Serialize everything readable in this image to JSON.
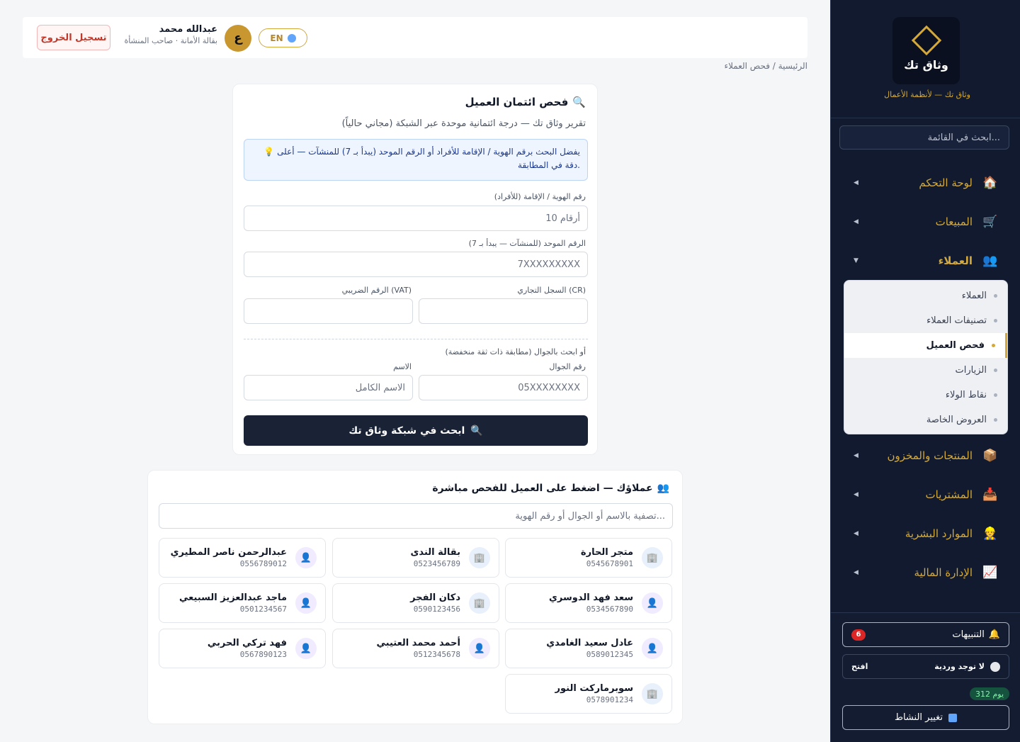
{
  "sidebar": {
    "logo_text": "وثاق تك",
    "tagline": "وثاق تك — لأنظمة الأعمال",
    "search_placeholder": "ابحث في القائمة...",
    "items": [
      {
        "label": "لوحة التحكم",
        "icon": "house-icon",
        "glyph": "🏠"
      },
      {
        "label": "المبيعات",
        "icon": "cart-icon",
        "glyph": "🛒"
      },
      {
        "label": "العملاء",
        "icon": "people-icon",
        "glyph": "👥"
      },
      {
        "label": "المنتجات والمخزون",
        "icon": "box-icon",
        "glyph": "📦"
      },
      {
        "label": "المشتريات",
        "icon": "inbox-icon",
        "glyph": "📥"
      },
      {
        "label": "الموارد البشرية",
        "icon": "worker-icon",
        "glyph": "👷"
      },
      {
        "label": "الإدارة المالية",
        "icon": "chart-icon",
        "glyph": "📈"
      }
    ],
    "submenu": [
      {
        "label": "العملاء"
      },
      {
        "label": "تصنيفات العملاء"
      },
      {
        "label": "فحص العميل"
      },
      {
        "label": "الزيارات"
      },
      {
        "label": "نقاط الولاء"
      },
      {
        "label": "العروض الخاصة"
      }
    ],
    "notifications": {
      "label": "التنبيهات",
      "count": "6",
      "glyph": "🔔"
    },
    "shift": {
      "label": "لا توجد وردية",
      "action": "افتح"
    },
    "days_badge": "312 يوم",
    "switch_label": "تغيير النشاط",
    "accent": "#d4a93a"
  },
  "topbar": {
    "logout_label": "تسجيل الخروج",
    "user_name": "عبدالله محمد",
    "user_sub": "بقالة الأمانة · صاحب المنشأة",
    "avatar_letter": "ع",
    "lang_label": "EN"
  },
  "breadcrumb": "الرئيسية / فحص العملاء",
  "credit": {
    "title": "فحص ائتمان العميل",
    "subtitle": "تقرير وثاق تك — درجة ائتمانية موحدة عبر الشبكة (مجاني حالياً)",
    "info": "💡 يفضل البحث برقم الهوية / الإقامة للأفراد أو الرقم الموحد (يبدأ بـ 7) للمنشآت — أعلى دقة في المطابقة.",
    "id_label": "رقم الهوية / الإقامة (للأفراد)",
    "id_placeholder": "10 أرقام",
    "unified_label": "الرقم الموحد (للمنشآت — يبدأ بـ 7)",
    "unified_placeholder": "7XXXXXXXXX",
    "cr_label": "السجل التجاري (CR)",
    "vat_label": "الرقم الضريبي (VAT)",
    "or_label": "أو ابحث بالجوال (مطابقة ذات ثقة منخفضة)",
    "mobile_label": "رقم الجوال",
    "mobile_placeholder": "05XXXXXXXX",
    "name_label": "الاسم",
    "name_placeholder": "الاسم الكامل",
    "search_button": "ابحث في شبكة وثاق تك"
  },
  "customers": {
    "title": "عملاؤك — اضغط على العميل للفحص مباشرة",
    "filter_placeholder": "تصفية بالاسم أو الجوال أو رقم الهوية...",
    "list": [
      {
        "name": "متجر الحارة",
        "phone": "0545678901",
        "type": "store"
      },
      {
        "name": "بقالة الندى",
        "phone": "0523456789",
        "type": "store"
      },
      {
        "name": "عبدالرحمن ناصر المطيري",
        "phone": "0556789012",
        "type": "person"
      },
      {
        "name": "سعد فهد الدوسري",
        "phone": "0534567890",
        "type": "person"
      },
      {
        "name": "دكان الفجر",
        "phone": "0590123456",
        "type": "store"
      },
      {
        "name": "ماجد عبدالعزيز السبيعي",
        "phone": "0501234567",
        "type": "person"
      },
      {
        "name": "عادل سعيد الغامدي",
        "phone": "0589012345",
        "type": "person"
      },
      {
        "name": "أحمد محمد العتيبي",
        "phone": "0512345678",
        "type": "person"
      },
      {
        "name": "فهد تركي الحربي",
        "phone": "0567890123",
        "type": "person"
      },
      {
        "name": "سوبرماركت النور",
        "phone": "0578901234",
        "type": "store"
      }
    ]
  }
}
